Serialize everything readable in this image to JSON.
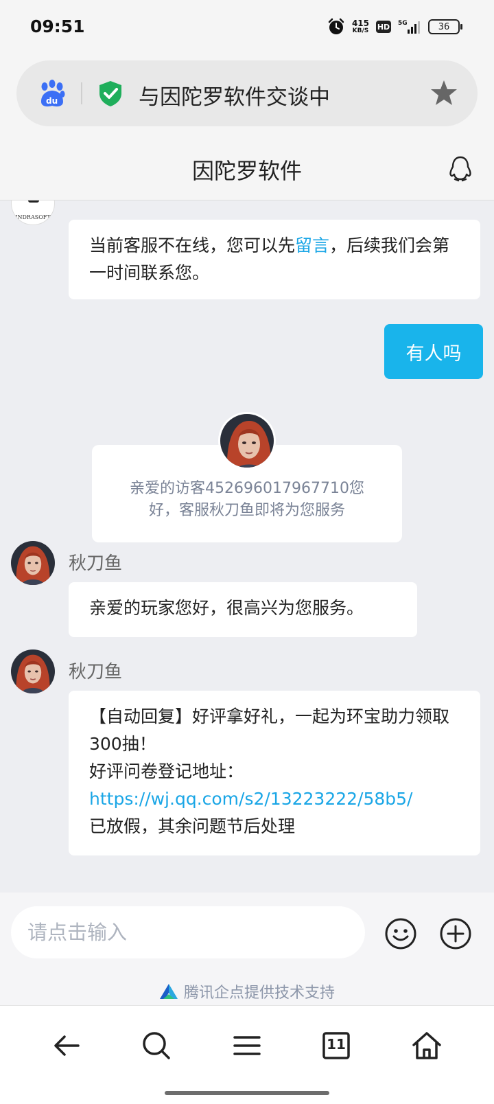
{
  "status_bar": {
    "time": "09:51",
    "net_speed_value": "415",
    "net_speed_unit": "KB/S",
    "hd_label": "HD",
    "network_label": "5G",
    "battery_level": "36"
  },
  "address_bar": {
    "title": "与因陀罗软件交谈中",
    "icons": [
      "baidu-paw-icon",
      "shield-check-icon",
      "star-icon"
    ]
  },
  "header": {
    "title": "因陀罗软件"
  },
  "chat": {
    "system_message": {
      "before_link": "当前客服不在线，您可以先",
      "link_text": "留言",
      "after_link": "，后续我们会第一时间联系您。",
      "avatar_brand_text": "INDRASOFT"
    },
    "user_message": "有人吗",
    "agent_join_notice": "亲爱的访客452696017967710您好，客服秋刀鱼即将为您服务",
    "messages": [
      {
        "sender": "秋刀鱼",
        "text": "亲爱的玩家您好，很高兴为您服务。"
      },
      {
        "sender": "秋刀鱼",
        "line1": "【自动回复】好评拿好礼，一起为环宝助力领取300抽！",
        "line2": "好评问卷登记地址：",
        "link": "https://wj.qq.com/s2/13223222/58b5/",
        "line3": "已放假，其余问题节后处理"
      }
    ]
  },
  "input_bar": {
    "placeholder": "请点击输入",
    "powered_by": "腾讯企点提供技术支持"
  },
  "nav_bar": {
    "tab_count": "11",
    "icons": [
      "back-arrow-icon",
      "search-icon",
      "menu-icon",
      "tabs-icon",
      "home-icon"
    ]
  },
  "colors": {
    "accent": "#19b4eb",
    "link": "#1aa6e6",
    "chat_background": "#edeef2"
  }
}
